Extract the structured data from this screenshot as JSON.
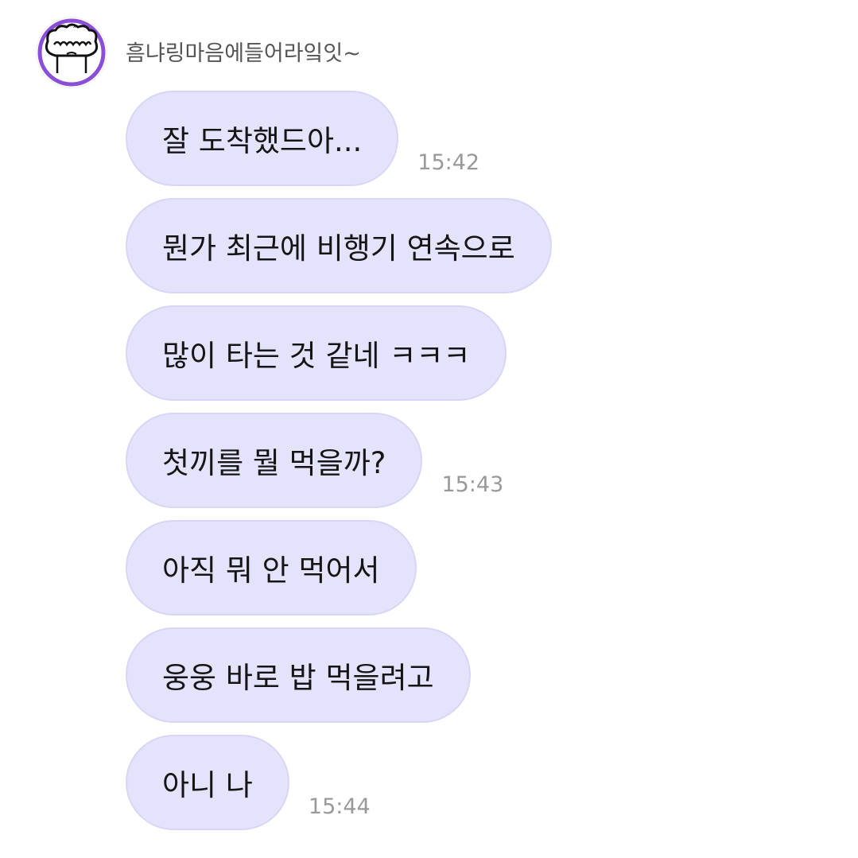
{
  "sender": {
    "name": "흠냐링마음에들어라잌잇~",
    "avatar_icon": "cartoon-face-avatar"
  },
  "colors": {
    "bubble": "#e5e2fc",
    "bubble_border": "#d9d5f6",
    "timestamp": "#999999",
    "avatar_accent": "#8a4fd6"
  },
  "messages": [
    {
      "text": "잘 도착했드아...",
      "time": "15:42"
    },
    {
      "text": "뭔가 최근에 비행기 연속으로",
      "time": ""
    },
    {
      "text": "많이 타는 것 같네 ㅋㅋㅋ",
      "time": ""
    },
    {
      "text": "첫끼를 뭘 먹을까?",
      "time": "15:43"
    },
    {
      "text": "아직 뭐 안 먹어서",
      "time": ""
    },
    {
      "text": "웅웅 바로 밥 먹을려고",
      "time": ""
    },
    {
      "text": "아니 나",
      "time": "15:44"
    }
  ]
}
